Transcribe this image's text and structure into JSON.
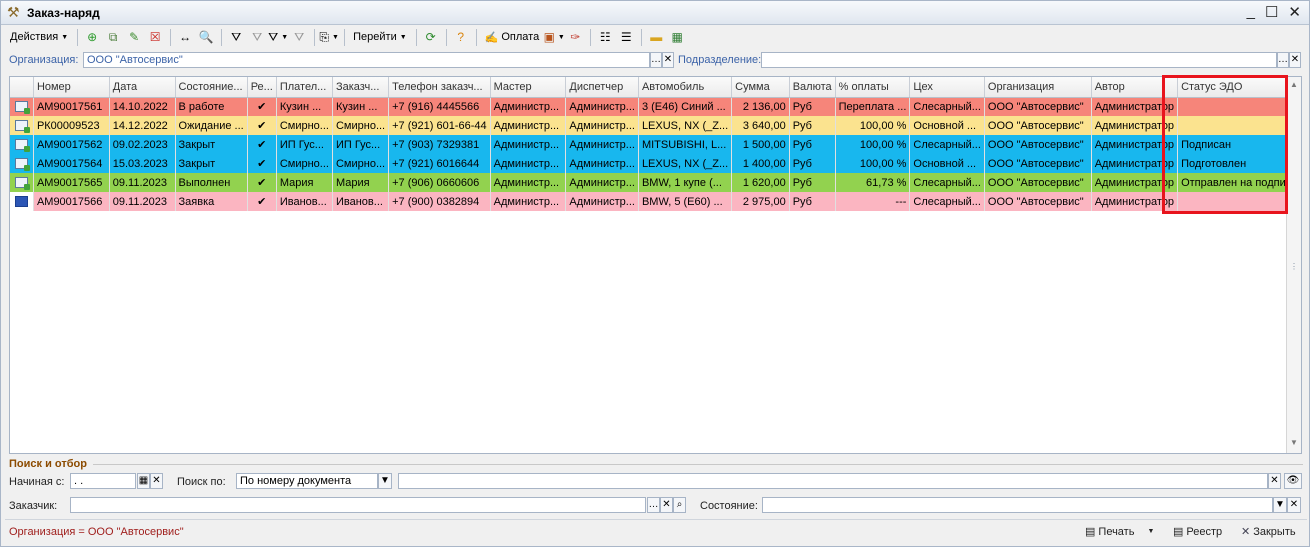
{
  "window": {
    "title": "Заказ-наряд",
    "controls": {
      "minimize": "_",
      "maximize": "☐",
      "close": "✕"
    }
  },
  "toolbar": {
    "actions_label": "Действия",
    "goto_label": "Перейти",
    "payment_label": "Оплата"
  },
  "filters": {
    "organization_label": "Организация:",
    "organization_value": "ООО \"Автосервис\"",
    "division_label": "Подразделение:",
    "division_value": ""
  },
  "table": {
    "columns": [
      "Номер",
      "Дата",
      "Состояние...",
      "Ре...",
      "Плател...",
      "Заказч...",
      "Телефон заказч...",
      "Мастер",
      "Диспетчер",
      "Автомобиль",
      "Сумма",
      "Валюта",
      "% оплаты",
      "Цех",
      "Организация",
      "Автор",
      "Статус ЭДО"
    ],
    "rows": [
      [
        "АМ90017561",
        "14.10.2022",
        "В работе",
        "✔",
        "Кузин ...",
        "Кузин ...",
        "+7 (916) 4445566",
        "Администр...",
        "Администр...",
        "3 (E46) Синий ...",
        "2 136,00",
        "Руб",
        "Переплата ...",
        "Слесарный...",
        "ООО \"Автосервис\"",
        "Администратор",
        ""
      ],
      [
        "РК00009523",
        "14.12.2022",
        "Ожидание ...",
        "✔",
        "Смирно...",
        "Смирно...",
        "+7 (921) 601-66-44",
        "Администр...",
        "Администр...",
        "LEXUS, NX (_Z...",
        "3 640,00",
        "Руб",
        "100,00 %",
        "Основной ...",
        "ООО \"Автосервис\"",
        "Администратор",
        ""
      ],
      [
        "АМ90017562",
        "09.02.2023",
        "Закрыт",
        "✔",
        "ИП Гус...",
        "ИП Гус...",
        "+7 (903) 7329381",
        "Администр...",
        "Администр...",
        "MITSUBISHI, L...",
        "1 500,00",
        "Руб",
        "100,00 %",
        "Слесарный...",
        "ООО \"Автосервис\"",
        "Администратор",
        "Подписан"
      ],
      [
        "АМ90017564",
        "15.03.2023",
        "Закрыт",
        "✔",
        "Смирно...",
        "Смирно...",
        "+7 (921) 6016644",
        "Администр...",
        "Администр...",
        "LEXUS, NX (_Z...",
        "1 400,00",
        "Руб",
        "100,00 %",
        "Основной ...",
        "ООО \"Автосервис\"",
        "Администратор",
        "Подготовлен"
      ],
      [
        "АМ90017565",
        "09.11.2023",
        "Выполнен",
        "✔",
        "Мария",
        "Мария",
        "+7 (906) 0660606",
        "Администр...",
        "Администр...",
        "BMW, 1 купе (...",
        "1 620,00",
        "Руб",
        "61,73 %",
        "Слесарный...",
        "ООО \"Автосервис\"",
        "Администратор",
        "Отправлен на подпись"
      ],
      [
        "АМ90017566",
        "09.11.2023",
        "Заявка",
        "✔",
        "Иванов...",
        "Иванов...",
        "+7 (900) 0382894",
        "Администр...",
        "Администр...",
        "BMW, 5 (E60) ...",
        "2 975,00",
        "Руб",
        "---",
        "Слесарный...",
        "ООО \"Автосервис\"",
        "Администратор",
        ""
      ]
    ],
    "row_colors": [
      "#f6857a",
      "#fbe38f",
      "#18b7ee",
      "#18b7ee",
      "#92d24f",
      "#fbb5c1"
    ]
  },
  "search": {
    "title": "Поиск и отбор",
    "start_label": "Начиная с:",
    "start_value": ". .",
    "search_by_label": "Поиск по:",
    "search_by_value": "По номеру документа",
    "search_value": "",
    "customer_label": "Заказчик:",
    "customer_value": "",
    "state_label": "Состояние:",
    "state_value": ""
  },
  "status": {
    "text": "Организация = ООО \"Автосервис\"",
    "print_label": "Печать",
    "registry_label": "Реестр",
    "close_label": "Закрыть"
  },
  "colors": {
    "accent_label": "#3c63a8",
    "highlight": "#e8141d",
    "status_text": "#a0201e",
    "search_title": "#8c4b00"
  }
}
